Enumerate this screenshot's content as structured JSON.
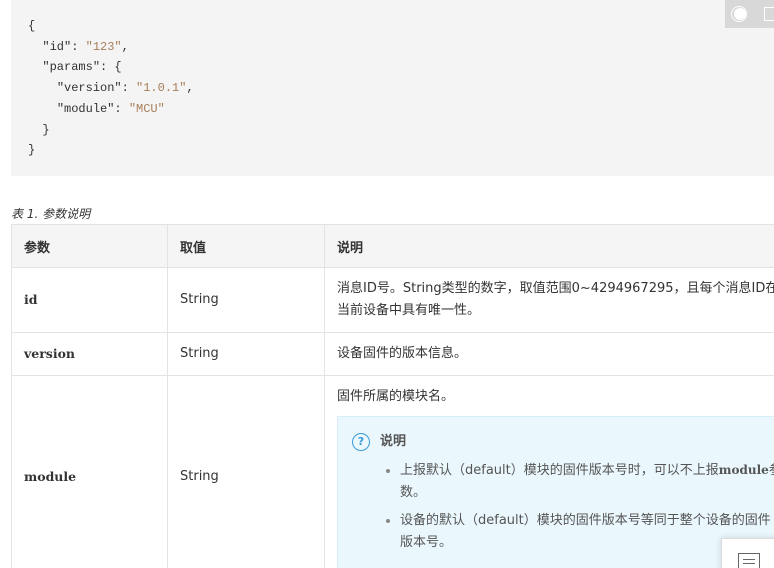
{
  "code": {
    "lines": [
      {
        "indent": "",
        "pre": "{",
        "str": "",
        "post": ""
      },
      {
        "indent": "  ",
        "pre": "\"id\": ",
        "str": "\"123\"",
        "post": ","
      },
      {
        "indent": "  ",
        "pre": "\"params\": {",
        "str": "",
        "post": ""
      },
      {
        "indent": "    ",
        "pre": "\"version\": ",
        "str": "\"1.0.1\"",
        "post": ","
      },
      {
        "indent": "    ",
        "pre": "\"module\": ",
        "str": "\"MCU\"",
        "post": ""
      },
      {
        "indent": "  ",
        "pre": "}",
        "str": "",
        "post": ""
      },
      {
        "indent": "",
        "pre": "}",
        "str": "",
        "post": ""
      }
    ]
  },
  "table": {
    "caption": "表 1. 参数说明",
    "headers": [
      "参数",
      "取值",
      "说明"
    ],
    "rows": [
      {
        "param": "id",
        "value": "String",
        "desc": "消息ID号。String类型的数字，取值范围0~4294967295，且每个消息ID在当前设备中具有唯一性。"
      },
      {
        "param": "version",
        "value": "String",
        "desc": "设备固件的版本信息。"
      },
      {
        "param": "module",
        "value": "String",
        "desc": "固件所属的模块名。",
        "note": {
          "title": "说明",
          "item1_pre": "上报默认（default）模块的固件版本号时，可以不上报",
          "item1_kw": "module",
          "item1_post": "参数。",
          "item2": "设备的默认（default）模块的固件版本号等同于整个设备的固件版本号。"
        }
      }
    ]
  },
  "icons": {
    "toggle": "theme-toggle-icon",
    "copy": "copy-icon",
    "help": "question-icon",
    "list": "list-icon"
  },
  "colors": {
    "code_bg": "#f4f4f4",
    "string": "#a67f59",
    "note_bg": "#eaf7fd",
    "accent": "#3a9bd9"
  }
}
